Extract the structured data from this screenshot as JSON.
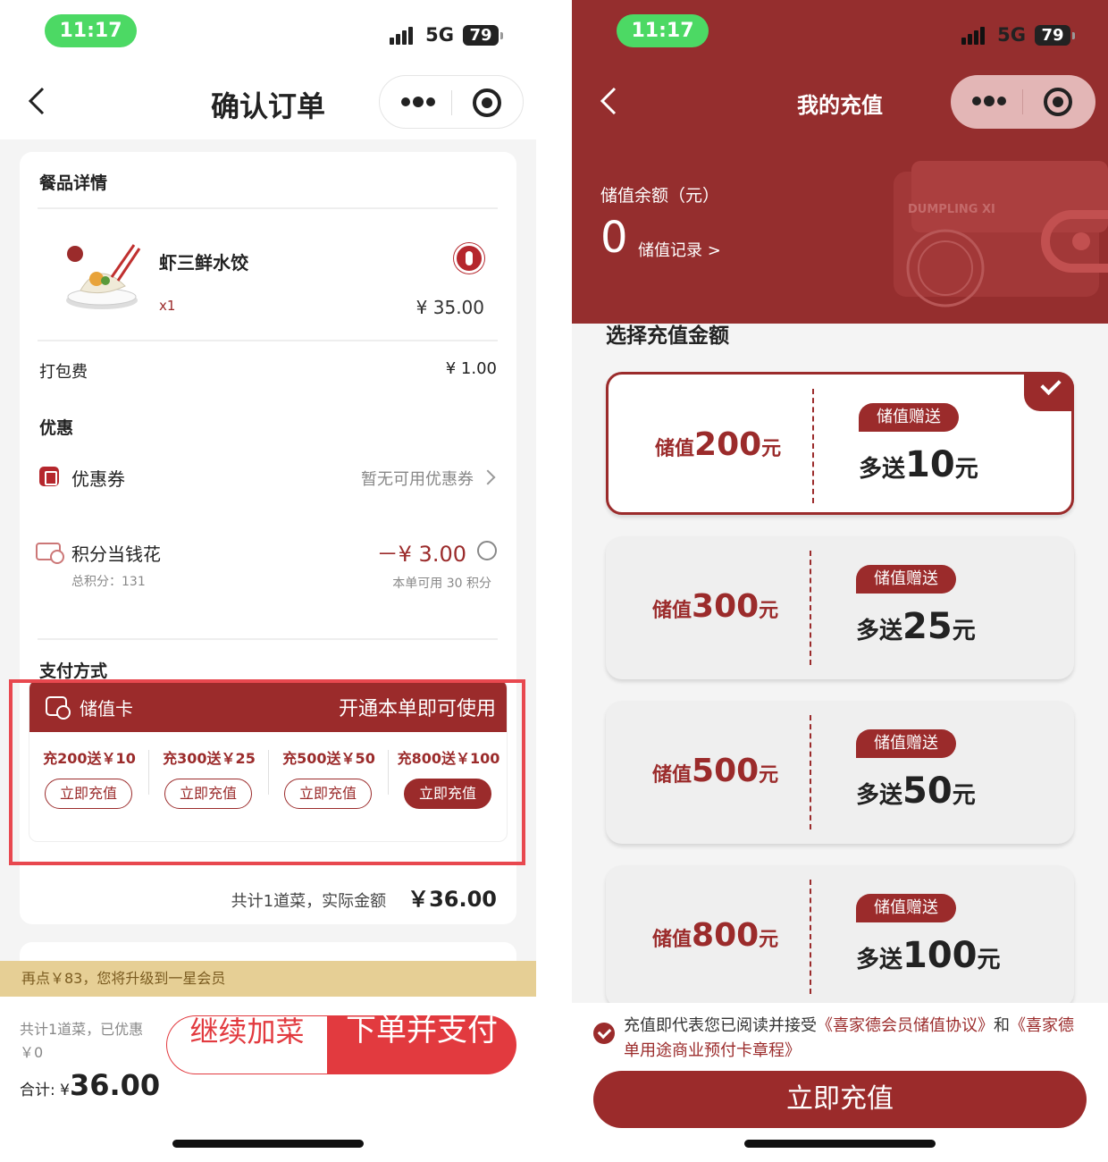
{
  "left": {
    "status": {
      "time": "11:17",
      "network": "5G",
      "battery": "79"
    },
    "nav": {
      "title": "确认订单"
    },
    "meal_section_title": "餐品详情",
    "dish": {
      "name": "虾三鲜水饺",
      "qty": "x1",
      "price": "¥ 35.00"
    },
    "packing": {
      "label": "打包费",
      "value": "¥ 1.00"
    },
    "discount_title": "优惠",
    "coupon": {
      "label": "优惠券",
      "value": "暂无可用优惠券"
    },
    "points": {
      "label": "积分当钱花",
      "total": "总积分：131",
      "deduct": "－¥ 3.00",
      "usable": "本单可用 30 积分"
    },
    "payment_title": "支付方式",
    "stored_card": {
      "label": "储值卡",
      "hint": "开通本单即可使用",
      "options": [
        {
          "label": "充200送￥10",
          "button": "立即充值"
        },
        {
          "label": "充300送￥25",
          "button": "立即充值"
        },
        {
          "label": "充500送￥50",
          "button": "立即充值"
        },
        {
          "label": "充800送￥100",
          "button": "立即充值"
        }
      ]
    },
    "total": {
      "text": "共计1道菜，实际金额",
      "amount": "￥36.00"
    },
    "upgrade": "再点￥83，您将升级到一星会员",
    "bottom": {
      "summary": "共计1道菜，已优惠￥0",
      "total_label": "合计: ¥",
      "total_amount": "36.00",
      "add_button": "继续加菜",
      "pay_button": "下单并支付"
    }
  },
  "right": {
    "status": {
      "time": "11:17",
      "network": "5G",
      "battery": "79"
    },
    "nav": {
      "title": "我的充值"
    },
    "balance": {
      "label": "储值余额（元）",
      "value": "0",
      "record": "储值记录 >"
    },
    "wallet_brand": "DUMPLING XI",
    "choose_title": "选择充值金额",
    "options": [
      {
        "prefix": "储值",
        "amount": "200",
        "unit": "元",
        "tag": "储值赠送",
        "bonus_prefix": "多送",
        "bonus": "10",
        "bonus_unit": "元",
        "selected": true
      },
      {
        "prefix": "储值",
        "amount": "300",
        "unit": "元",
        "tag": "储值赠送",
        "bonus_prefix": "多送",
        "bonus": "25",
        "bonus_unit": "元",
        "selected": false
      },
      {
        "prefix": "储值",
        "amount": "500",
        "unit": "元",
        "tag": "储值赠送",
        "bonus_prefix": "多送",
        "bonus": "50",
        "bonus_unit": "元",
        "selected": false
      },
      {
        "prefix": "储值",
        "amount": "800",
        "unit": "元",
        "tag": "储值赠送",
        "bonus_prefix": "多送",
        "bonus": "100",
        "bonus_unit": "元",
        "selected": false
      }
    ],
    "agreement": {
      "prefix": "充值即代表您已阅读并接受",
      "link1": "《喜家德会员储值协议》",
      "mid": "和",
      "link2": "《喜家德单用途商业预付卡章程》"
    },
    "recharge_button": "立即充值"
  },
  "colors": {
    "brand_red": "#9b2b2b",
    "accent_red": "#e23a3f",
    "highlight_border": "#e8484f",
    "status_green": "#4cd964",
    "upgrade_bar": "#e6cf95"
  }
}
